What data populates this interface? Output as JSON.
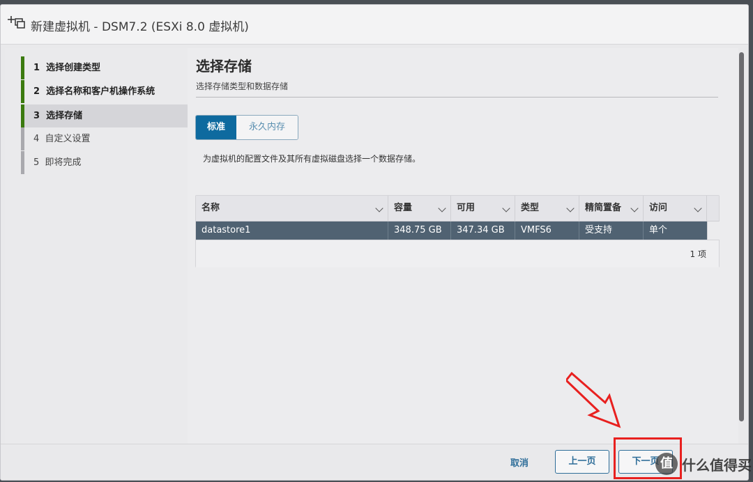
{
  "window": {
    "title": "新建虚拟机 - DSM7.2 (ESXi 8.0 虚拟机)"
  },
  "steps": [
    {
      "num": "1",
      "label": "选择创建类型",
      "state": "done"
    },
    {
      "num": "2",
      "label": "选择名称和客户机操作系统",
      "state": "done"
    },
    {
      "num": "3",
      "label": "选择存储",
      "state": "active"
    },
    {
      "num": "4",
      "label": "自定义设置",
      "state": "todo"
    },
    {
      "num": "5",
      "label": "即将完成",
      "state": "todo"
    }
  ],
  "main": {
    "title": "选择存储",
    "subtitle": "选择存储类型和数据存储",
    "tabs": [
      {
        "label": "标准",
        "selected": true
      },
      {
        "label": "永久内存",
        "selected": false
      }
    ],
    "description": "为虚拟机的配置文件及其所有虚拟磁盘选择一个数据存储。"
  },
  "table": {
    "columns": [
      "名称",
      "容量",
      "可用",
      "类型",
      "精简置备",
      "访问"
    ],
    "rows": [
      [
        "datastore1",
        "348.75 GB",
        "347.34 GB",
        "VMFS6",
        "受支持",
        "单个"
      ]
    ],
    "count": "1 项"
  },
  "footer": {
    "cancel": "取消",
    "prev": "上一页",
    "next": "下一页"
  },
  "watermark": {
    "badge": "值",
    "text": "什么值得买"
  },
  "colors": {
    "accent": "#0e6a9f",
    "step_done": "#3b7a0f",
    "row_selected": "#506272",
    "highlight": "#e8201f"
  }
}
